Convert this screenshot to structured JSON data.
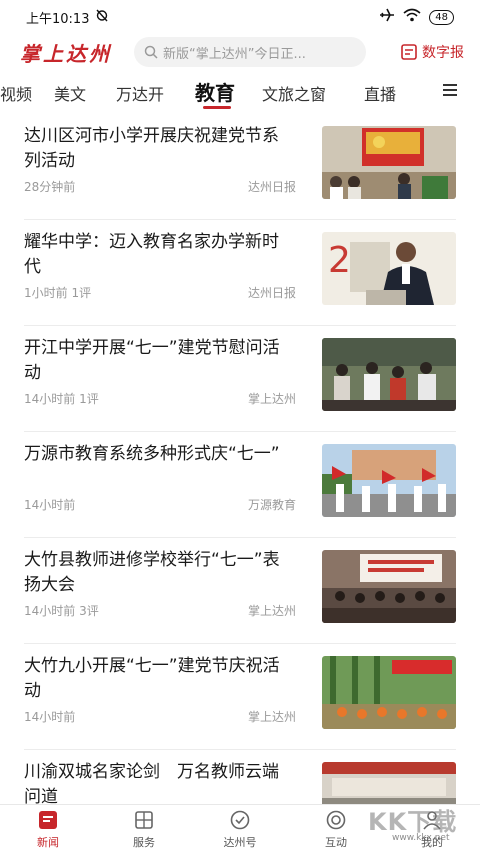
{
  "status_bar": {
    "time": "上午10:13",
    "battery": "48"
  },
  "header": {
    "logo": "掌上达州",
    "search_placeholder": "新版“掌上达州”今日正...",
    "epaper_label": "数字报"
  },
  "tabs": [
    {
      "label": "视频"
    },
    {
      "label": "美文"
    },
    {
      "label": "万达开"
    },
    {
      "label": "教育",
      "active": true
    },
    {
      "label": "文旅之窗"
    },
    {
      "label": "直播"
    }
  ],
  "news": [
    {
      "title": "达川区河市小学开展庆祝建党节系列活动",
      "time": "28分钟前",
      "comments": "",
      "source": "达州日报",
      "thumb": "party-meeting-photo"
    },
    {
      "title": "耀华中学：迈入教育名家办学新时代",
      "time": "1小时前",
      "comments": "1评",
      "source": "达州日报",
      "thumb": "speaker-podium-photo"
    },
    {
      "title": "开江中学开展“七一”建党节慰问活动",
      "time": "14小时前",
      "comments": "1评",
      "source": "掌上达州",
      "thumb": "visit-meeting-photo"
    },
    {
      "title": "万源市教育系统多种形式庆“七一”",
      "time": "14小时前",
      "comments": "",
      "source": "万源教育",
      "thumb": "flag-parade-photo"
    },
    {
      "title": "大竹县教师进修学校举行“七一”表扬大会",
      "time": "14小时前",
      "comments": "3评",
      "source": "掌上达州",
      "thumb": "assembly-hall-photo"
    },
    {
      "title": "大竹九小开展“七一”建党节庆祝活动",
      "time": "14小时前",
      "comments": "",
      "source": "掌上达州",
      "thumb": "outdoor-activity-photo"
    },
    {
      "title": "川渝双城名家论剑　万名教师云端问道",
      "time": "",
      "comments": "",
      "source": "",
      "thumb": "conference-photo"
    }
  ],
  "bottom_nav": [
    {
      "label": "新闻",
      "icon": "news-icon",
      "active": true
    },
    {
      "label": "服务",
      "icon": "service-icon"
    },
    {
      "label": "达州号",
      "icon": "dazhou-hao-icon"
    },
    {
      "label": "互动",
      "icon": "interact-icon"
    },
    {
      "label": "我的",
      "icon": "profile-icon"
    }
  ],
  "watermark": {
    "text": "KK下载",
    "url": "www.kkx.net"
  },
  "colors": {
    "accent": "#c7262b",
    "text": "#1a1a1a",
    "meta": "#9a9a9a",
    "divider": "#ececec"
  }
}
